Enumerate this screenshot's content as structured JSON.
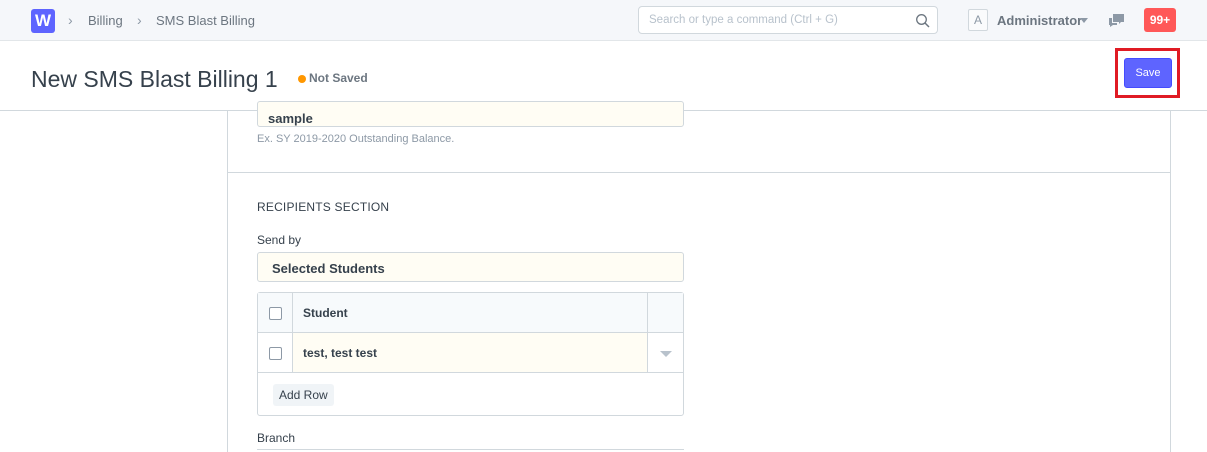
{
  "navbar": {
    "logo_letter": "W",
    "breadcrumbs": [
      "Billing",
      "SMS Blast Billing"
    ],
    "search_placeholder": "Search or type a command (Ctrl + G)",
    "avatar_letter": "A",
    "user_name": "Administrator",
    "notification_count": "99+"
  },
  "page_head": {
    "title": "New SMS Blast Billing 1",
    "status": "Not Saved",
    "save_label": "Save"
  },
  "form": {
    "title_field_value": "sample",
    "title_field_description": "Ex. SY 2019-2020 Outstanding Balance.",
    "recipients_section_title": "RECIPIENTS SECTION",
    "send_by_label": "Send by",
    "send_by_value": "Selected Students",
    "grid": {
      "column_header": "Student",
      "rows": [
        "test, test test"
      ],
      "add_row_label": "Add Row"
    },
    "branch_label": "Branch"
  },
  "colors": {
    "brand": "#5e64ff",
    "notification": "#ff5858",
    "status_dot": "#ff9700",
    "highlight": "#e01b24"
  }
}
